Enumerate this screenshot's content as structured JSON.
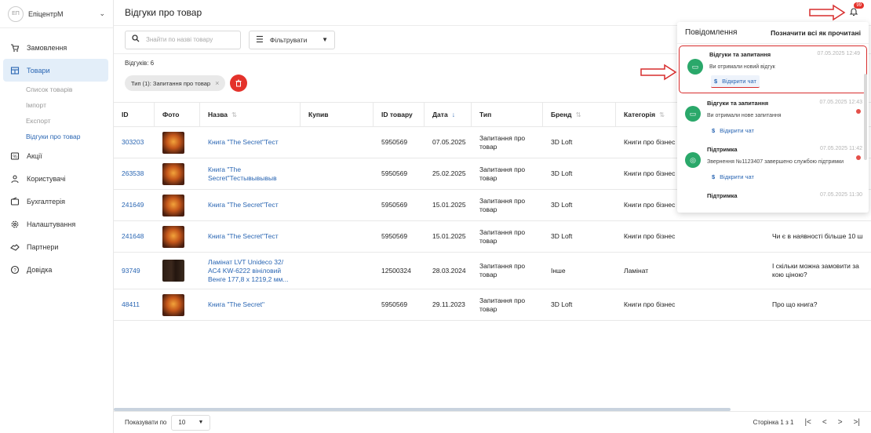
{
  "sidebar": {
    "avatar_initials": "ЕП",
    "store_name": "ЕпіцентрМ",
    "items": [
      {
        "label": "Замовлення",
        "icon": "cart-icon"
      },
      {
        "label": "Товари",
        "icon": "store-icon",
        "active": true
      },
      {
        "label": "Акції",
        "icon": "percent-icon"
      },
      {
        "label": "Користувачі",
        "icon": "users-icon"
      },
      {
        "label": "Бухгалтерія",
        "icon": "wallet-icon"
      },
      {
        "label": "Налаштування",
        "icon": "gear-icon"
      },
      {
        "label": "Партнери",
        "icon": "handshake-icon"
      },
      {
        "label": "Довідка",
        "icon": "help-icon"
      }
    ],
    "subitems": [
      "Список товарів",
      "Імпорт",
      "Експорт",
      "Відгуки про товар"
    ]
  },
  "header": {
    "title": "Відгуки про товар",
    "badge": "99"
  },
  "toolbar": {
    "search_placeholder": "Знайти по назві товару",
    "filter_label": "Фільтрувати"
  },
  "count_label": "Відгуків: 6",
  "chip_label": "Тип (1): Запитання про товар",
  "table": {
    "headers": [
      "ID",
      "Фото",
      "Назва",
      "Купив",
      "ID товару",
      "Дата",
      "Тип",
      "Бренд",
      "Категорія",
      ""
    ],
    "rows": [
      {
        "id": "303203",
        "name": "Книга \"The Secret\"Тест",
        "pid": "5950569",
        "date": "07.05.2025",
        "type": "Запитання про товар",
        "brand": "3D Loft",
        "cat": "Книги про бізнес",
        "text": "",
        "img": "book"
      },
      {
        "id": "263538",
        "name": "Книга \"The Secret\"Тестывывывыв",
        "pid": "5950569",
        "date": "25.02.2025",
        "type": "Запитання про товар",
        "brand": "3D Loft",
        "cat": "Книги про бізнес",
        "text": "",
        "img": "book"
      },
      {
        "id": "241649",
        "name": "Книга \"The Secret\"Тест",
        "pid": "5950569",
        "date": "15.01.2025",
        "type": "Запитання про товар",
        "brand": "3D Loft",
        "cat": "Книги про бізнес",
        "text": "",
        "img": "book"
      },
      {
        "id": "241648",
        "name": "Книга \"The Secret\"Тест",
        "pid": "5950569",
        "date": "15.01.2025",
        "type": "Запитання про товар",
        "brand": "3D Loft",
        "cat": "Книги про бізнес",
        "text": "Чи є в наявності більше 10 ш",
        "img": "book"
      },
      {
        "id": "93749",
        "name": "Ламінат LVT Unideco 32/АС4 KW-6222 вініловий Венге 177,8 х 1219,2 мм...",
        "pid": "12500324",
        "date": "28.03.2024",
        "type": "Запитання про товар",
        "brand": "Інше",
        "cat": "Ламінат",
        "text": "І скільки можна замовити за кою ціною?",
        "img": "laminate"
      },
      {
        "id": "48411",
        "name": "Книга \"The Secret\"",
        "pid": "5950569",
        "date": "29.11.2023",
        "type": "Запитання про товар",
        "brand": "3D Loft",
        "cat": "Книги про бізнес",
        "text": "Про що книга?",
        "img": "book"
      }
    ]
  },
  "footer": {
    "show_label": "Показувати по",
    "page_size": "10",
    "page_text": "Сторінка 1 з 1"
  },
  "notifications": {
    "title": "Повідомлення",
    "mark_all": "Позначити всі як прочитані",
    "items": [
      {
        "title": "Відгуки та запитання",
        "time": "07.05.2025 12:49",
        "msg": "Ви отримали новий відгук",
        "btn": "Відкрити чат"
      },
      {
        "title": "Відгуки та запитання",
        "time": "07.05.2025 12:43",
        "msg": "Ви отримали нове запитання",
        "btn": "Відкрити чат"
      },
      {
        "title": "Підтримка",
        "time": "07.05.2025 11:42",
        "msg": "Звернення №1123407 завершено службою підтримки",
        "btn": "Відкрити чат"
      },
      {
        "title": "Підтримка",
        "time": "07.05.2025 11:30",
        "msg": "",
        "btn": ""
      }
    ]
  }
}
